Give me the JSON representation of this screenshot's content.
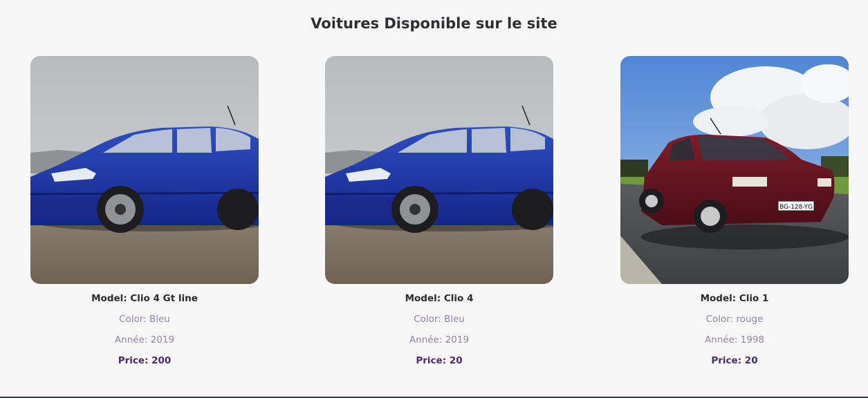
{
  "page": {
    "title": "Voitures Disponible sur le site"
  },
  "cars": [
    {
      "image": "blue-hatchback-photo",
      "model": "Model: Clio 4 Gt line",
      "color": "Color: Bleu",
      "year": "Année: 2019",
      "price": "Price: 200"
    },
    {
      "image": "blue-hatchback-photo",
      "model": "Model: Clio 4",
      "color": "Color: Bleu",
      "year": "Année: 2019",
      "price": "Price: 20"
    },
    {
      "image": "red-hatchback-photo",
      "model": "Model: Clio 1",
      "color": "Color: rouge",
      "year": "Année: 1998",
      "price": "Price: 20",
      "plate": "BG-128-YG"
    }
  ],
  "colors": {
    "background": "#f7f7f7",
    "title": "#2f2f33",
    "muted_text": "#8e83a8",
    "price_text": "#4b2a6b",
    "blue_car": "#1e3aa0",
    "red_car": "#6b1320"
  }
}
